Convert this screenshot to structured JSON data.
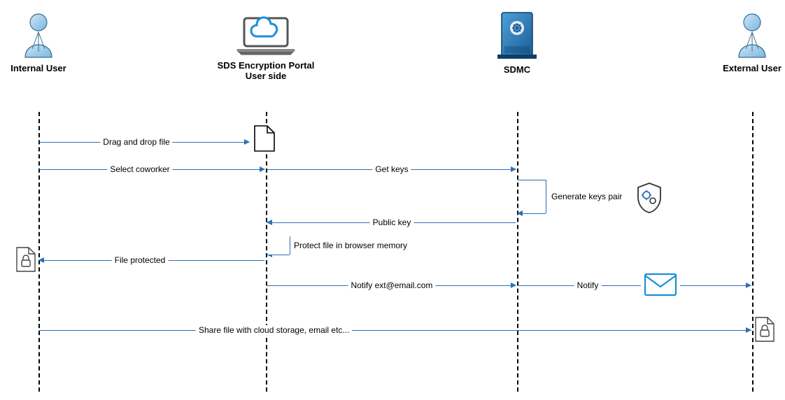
{
  "actors": {
    "internal": {
      "label": "Internal User"
    },
    "portal": {
      "label": "SDS Encryption Portal\nUser side"
    },
    "sdmc": {
      "label": "SDMC"
    },
    "external": {
      "label": "External User"
    }
  },
  "messages": {
    "drag": "Drag and drop file",
    "select": "Select coworker",
    "getkeys": "Get keys",
    "genkeys": "Generate keys pair",
    "pubkey": "Public key",
    "protect": "Protect file in browser memory",
    "protected": "File protected",
    "notify1": "Notify ext@email.com",
    "notify2": "Notify",
    "share": "Share file with cloud storage, email etc..."
  }
}
